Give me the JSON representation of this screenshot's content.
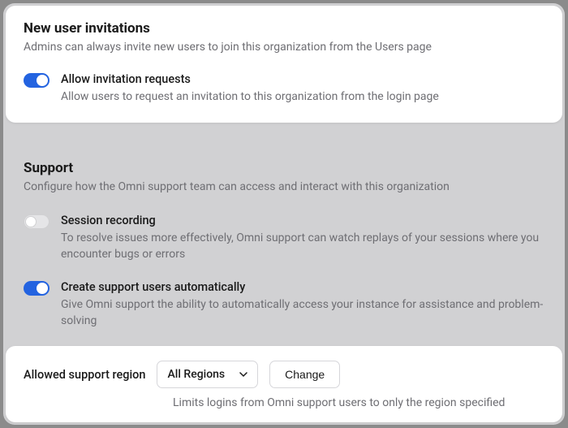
{
  "invitations": {
    "title": "New user invitations",
    "description": "Admins can always invite new users to join this organization from the Users page",
    "allow_requests": {
      "enabled": true,
      "label": "Allow invitation requests",
      "description": "Allow users to request an invitation to this organization from the login page"
    }
  },
  "support": {
    "title": "Support",
    "description": "Configure how the Omni support team can access and interact with this organization",
    "session_recording": {
      "enabled": false,
      "label": "Session recording",
      "description": "To resolve issues more effectively, Omni support can watch replays of your sessions where you encounter bugs or errors"
    },
    "auto_support_users": {
      "enabled": true,
      "label": "Create support users automatically",
      "description": "Give Omni support the ability to automatically access your instance for assistance and problem-solving"
    },
    "allowed_region": {
      "label": "Allowed support region",
      "selected": "All Regions",
      "change_button": "Change",
      "help": "Limits logins from Omni support users to only the region specified"
    }
  }
}
